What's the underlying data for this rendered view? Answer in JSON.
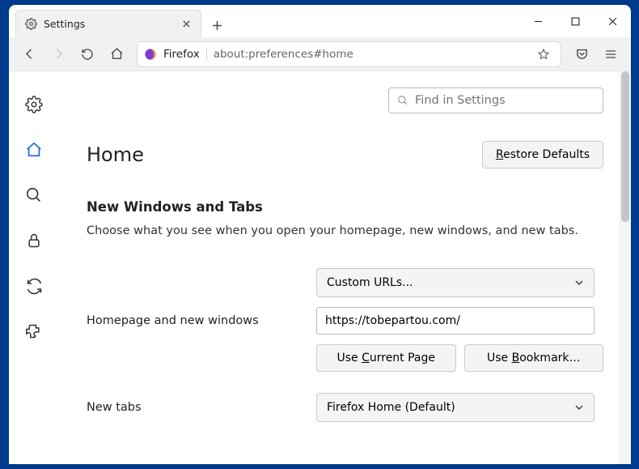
{
  "tab": {
    "title": "Settings"
  },
  "urlbar": {
    "prefix": "Firefox",
    "path": "about:preferences#home"
  },
  "search": {
    "placeholder": "Find in Settings"
  },
  "page": {
    "heading": "Home",
    "restore": "Restore Defaults",
    "restore_ul": "R",
    "section_title": "New Windows and Tabs",
    "section_desc": "Choose what you see when you open your homepage, new windows, and new tabs."
  },
  "form": {
    "homepage_label": "Homepage and new windows",
    "homepage_select": "Custom URLs...",
    "homepage_url": "https://tobepartou.com/",
    "use_current": "Use Current Page",
    "use_current_ul": "C",
    "use_bookmark": "Use Bookmark…",
    "use_bookmark_ul": "B",
    "newtabs_label": "New tabs",
    "newtabs_select": "Firefox Home (Default)"
  }
}
